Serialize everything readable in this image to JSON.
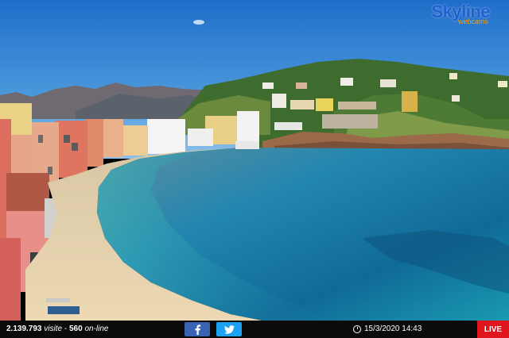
{
  "brand": {
    "name": "Skyline",
    "sub": "webcams"
  },
  "footer": {
    "visits_count": "2.139.793",
    "visits_label": "visite",
    "online_count": "560",
    "online_label": "on-line",
    "datetime": "15/3/2020 14:43",
    "live_label": "LIVE"
  },
  "icons": {
    "facebook": "facebook-icon",
    "twitter": "twitter-icon",
    "clock": "clock-icon"
  },
  "colors": {
    "sky": "#3f8fd7",
    "sea": "#1a79a4",
    "beach": "#e3cfa9",
    "bar": "#0b0b0b",
    "live": "#e0161e"
  }
}
